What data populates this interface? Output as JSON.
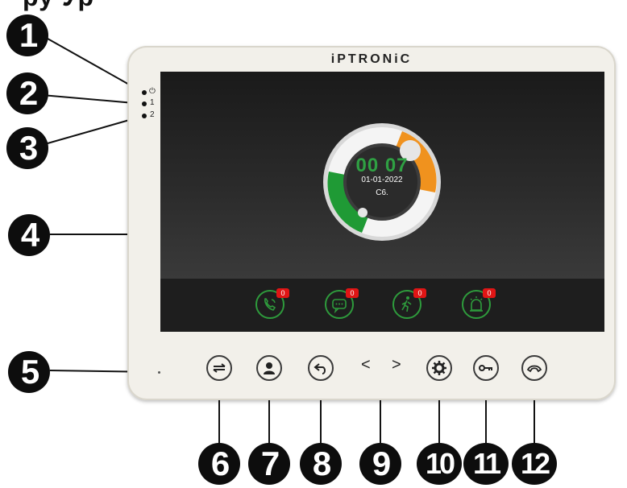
{
  "header": {
    "heading_fragment": "ру Ур"
  },
  "device": {
    "brand": "iPTRONiC"
  },
  "leds": [
    {
      "label": "⏻"
    },
    {
      "label": "1"
    },
    {
      "label": "2"
    }
  ],
  "clock": {
    "time": "00 07",
    "date": "01-01-2022",
    "weekday": "C6.",
    "colors": {
      "orange": "#f0921e",
      "green": "#1f9a35",
      "time_green": "#2fa043"
    }
  },
  "status_icons": [
    {
      "icon": "phone-icon",
      "count": "0"
    },
    {
      "icon": "message-icon",
      "count": "0"
    },
    {
      "icon": "motion-icon",
      "count": "0"
    },
    {
      "icon": "alarm-icon",
      "count": "0"
    }
  ],
  "buttons": [
    {
      "icon": "switch-arrows-icon"
    },
    {
      "icon": "user-icon"
    },
    {
      "icon": "back-arrow-icon"
    },
    {
      "icon": "gear-icon"
    },
    {
      "icon": "key-icon"
    },
    {
      "icon": "hangup-icon"
    }
  ],
  "nav": {
    "left": "<",
    "right": ">"
  },
  "callouts": [
    "1",
    "2",
    "3",
    "4",
    "5",
    "6",
    "7",
    "8",
    "9",
    "10",
    "11",
    "12"
  ]
}
